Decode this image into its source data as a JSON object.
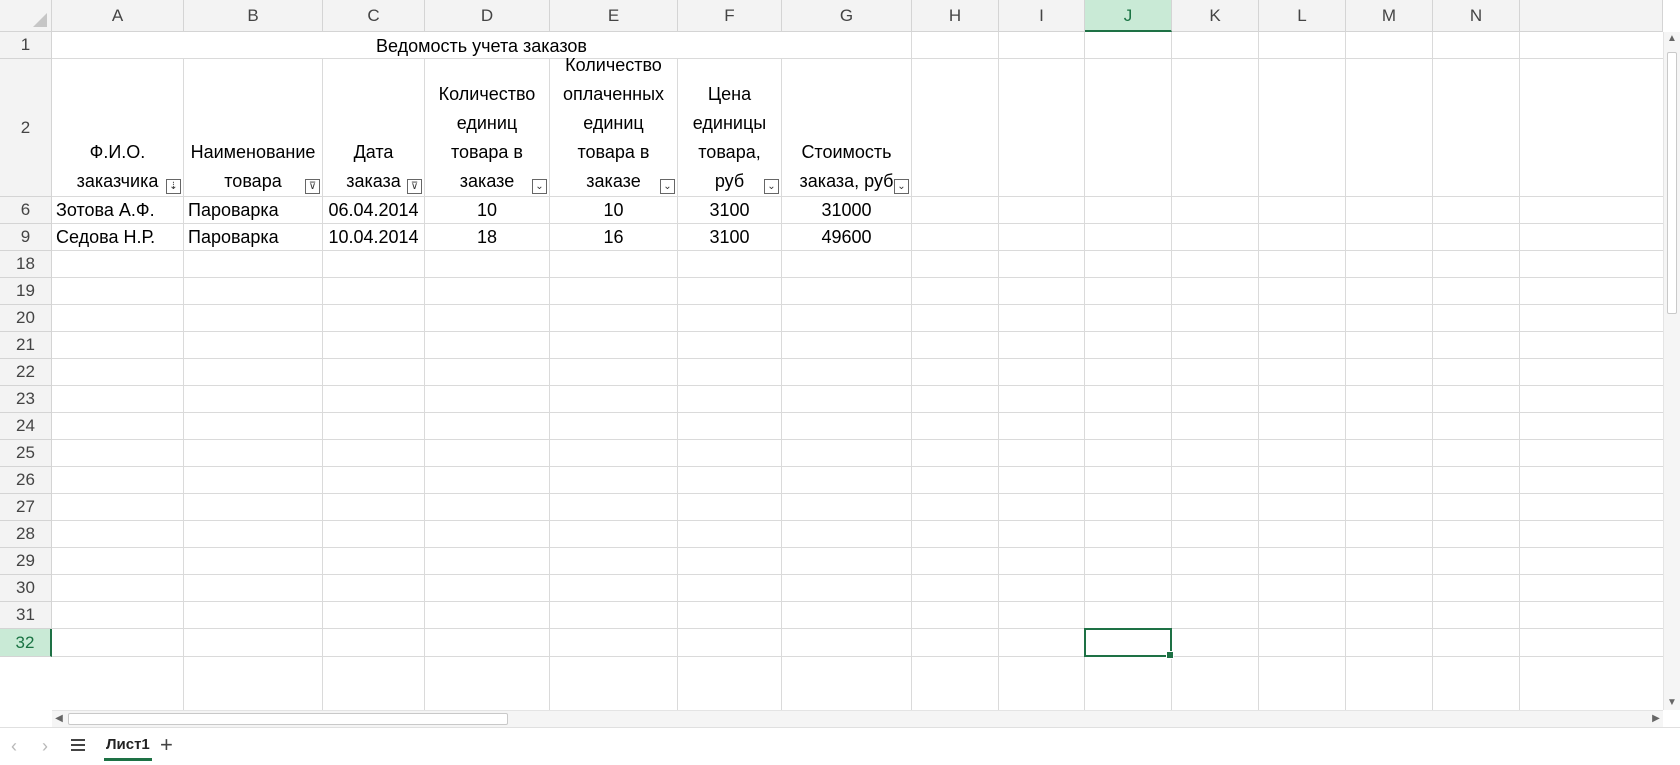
{
  "columns": [
    {
      "letter": "A",
      "active": false
    },
    {
      "letter": "B",
      "active": false
    },
    {
      "letter": "C",
      "active": false
    },
    {
      "letter": "D",
      "active": false
    },
    {
      "letter": "E",
      "active": false
    },
    {
      "letter": "F",
      "active": false
    },
    {
      "letter": "G",
      "active": false
    },
    {
      "letter": "H",
      "active": false
    },
    {
      "letter": "I",
      "active": false
    },
    {
      "letter": "J",
      "active": true
    },
    {
      "letter": "K",
      "active": false
    },
    {
      "letter": "L",
      "active": false
    },
    {
      "letter": "M",
      "active": false
    },
    {
      "letter": "N",
      "active": false
    }
  ],
  "rows": [
    {
      "label": "1",
      "active": false
    },
    {
      "label": "2",
      "active": false
    },
    {
      "label": "6",
      "active": false
    },
    {
      "label": "9",
      "active": false
    },
    {
      "label": "18",
      "active": false
    },
    {
      "label": "19",
      "active": false
    },
    {
      "label": "20",
      "active": false
    },
    {
      "label": "21",
      "active": false
    },
    {
      "label": "22",
      "active": false
    },
    {
      "label": "23",
      "active": false
    },
    {
      "label": "24",
      "active": false
    },
    {
      "label": "25",
      "active": false
    },
    {
      "label": "26",
      "active": false
    },
    {
      "label": "27",
      "active": false
    },
    {
      "label": "28",
      "active": false
    },
    {
      "label": "29",
      "active": false
    },
    {
      "label": "30",
      "active": false
    },
    {
      "label": "31",
      "active": false
    },
    {
      "label": "32",
      "active": true
    }
  ],
  "title": "Ведомость учета заказов",
  "headers": [
    {
      "lines": [
        "Ф.И.О.",
        "заказчика"
      ],
      "filter_icon": "sort-filter-icon"
    },
    {
      "lines": [
        "Наименование",
        "товара"
      ],
      "filter_icon": "active-filter-icon"
    },
    {
      "lines": [
        "Дата",
        "заказа"
      ],
      "filter_icon": "active-filter-icon"
    },
    {
      "lines": [
        "Количество",
        "единиц",
        "товара в",
        "заказе"
      ],
      "filter_icon": "dropdown-icon"
    },
    {
      "lines": [
        "Количество",
        "оплаченных",
        "единиц",
        "товара в",
        "заказе"
      ],
      "filter_icon": "dropdown-icon"
    },
    {
      "lines": [
        "Цена",
        "единицы",
        "товара,",
        "руб"
      ],
      "filter_icon": "dropdown-icon"
    },
    {
      "lines": [
        "Стоимость",
        "заказа, руб"
      ],
      "filter_icon": "dropdown-icon"
    }
  ],
  "data_rows": [
    [
      "Зотова А.Ф.",
      "Пароварка",
      "06.04.2014",
      "10",
      "10",
      "3100",
      "31000"
    ],
    [
      "Седова Н.Р.",
      "Пароварка",
      "10.04.2014",
      "18",
      "16",
      "3100",
      "49600"
    ]
  ],
  "selected_cell": "J32",
  "sheet_tab": "Лист1",
  "accent_color": "#1e7145"
}
